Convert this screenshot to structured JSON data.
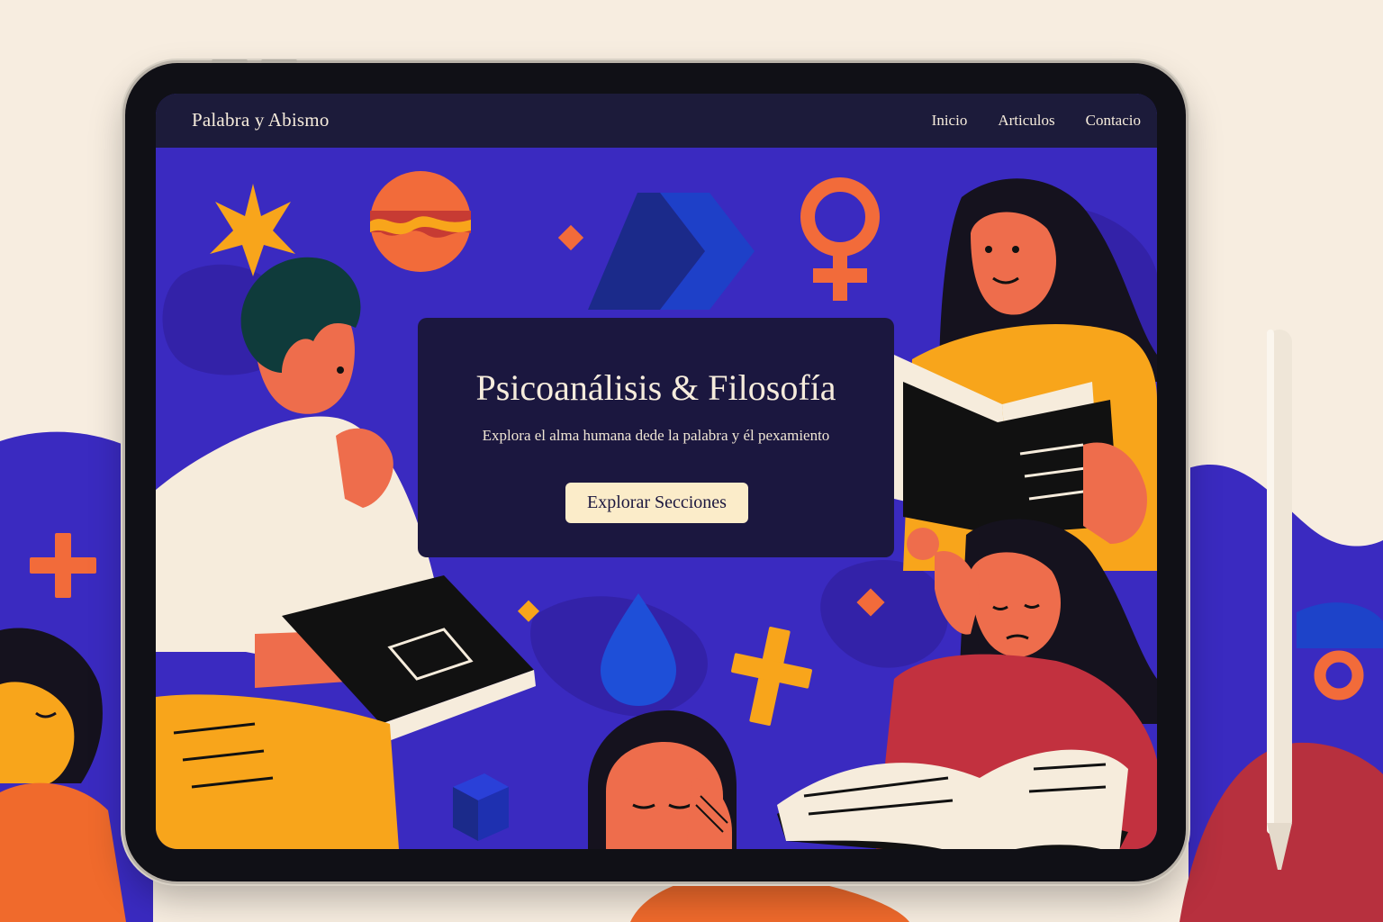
{
  "header": {
    "brand": "Palabra y Abismo",
    "nav": [
      "Inicio",
      "Articulos",
      "Contacio"
    ]
  },
  "hero": {
    "title": "Psicoanálisis & Filosofía",
    "subtitle": "Explora el alma humana dede la palabra y él pexamiento",
    "cta_label": "Explorar Secciones"
  },
  "colors": {
    "page_background": "#f7ede0",
    "hero_background": "#3a2ac0",
    "navbar": "#1c1b3a",
    "card": "#1b173f",
    "cta": "#fbecc9",
    "accent_orange": "#f26b3a",
    "accent_yellow": "#f8a51b"
  },
  "icons": [
    "star-icon",
    "planet-icon",
    "venus-symbol-icon",
    "plus-icon",
    "diamond-icon",
    "droplet-icon",
    "cross-icon",
    "cube-icon"
  ]
}
